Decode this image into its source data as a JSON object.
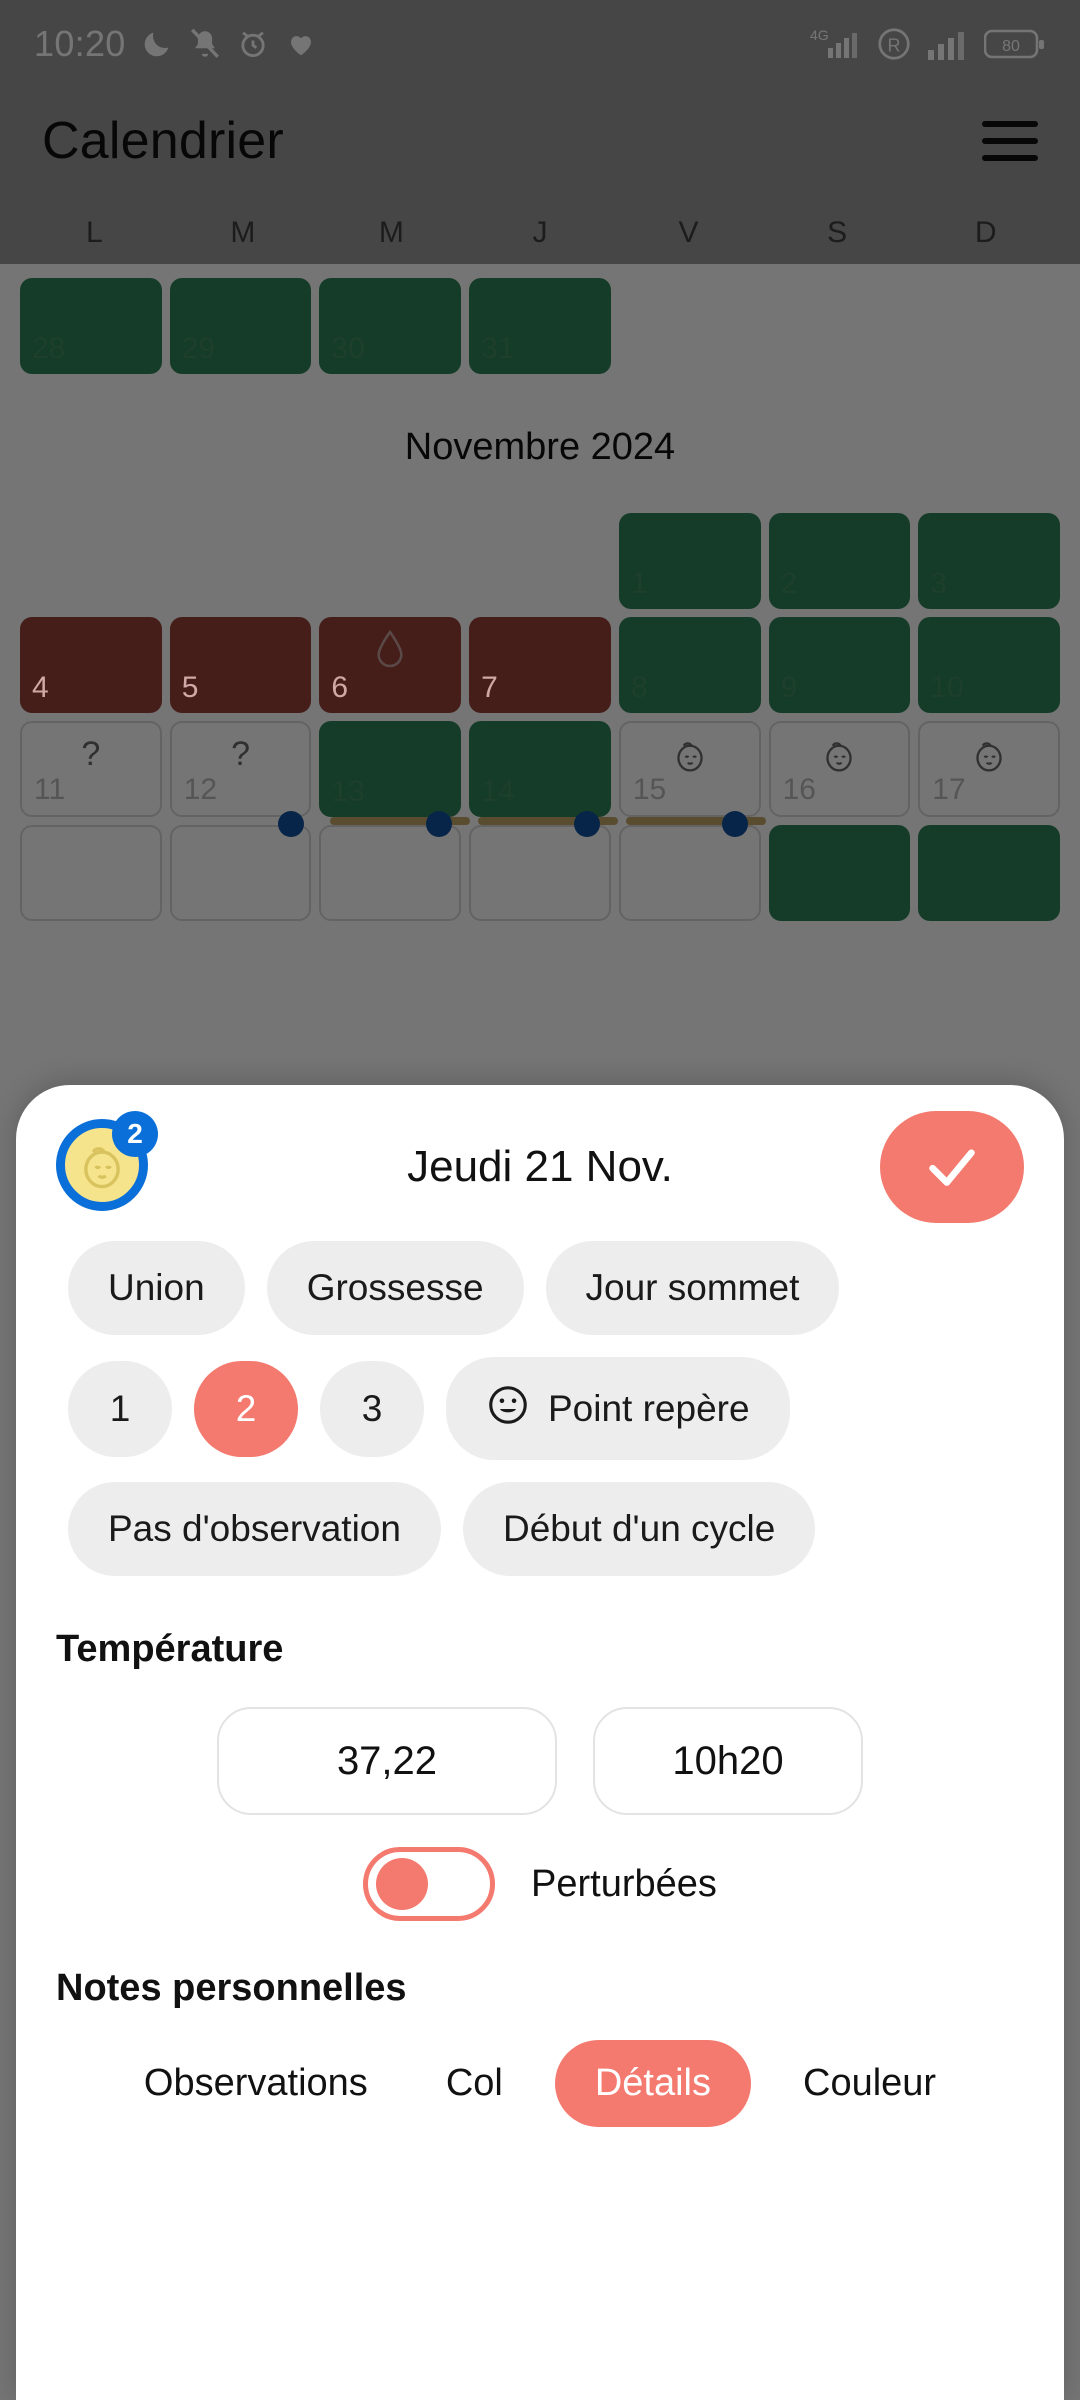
{
  "status_bar": {
    "time": "10:20",
    "left_icons": [
      "moon-icon",
      "bell-muted-icon",
      "alarm-icon",
      "heart-icon"
    ],
    "network_label": "4G",
    "roaming_label": "R",
    "battery_level": "80"
  },
  "app": {
    "title": "Calendrier",
    "menu_icon": "hamburger-icon"
  },
  "calendar": {
    "weekdays": [
      "L",
      "M",
      "M",
      "J",
      "V",
      "S",
      "D"
    ],
    "prev_month_row": [
      {
        "day": "28",
        "state": "green"
      },
      {
        "day": "29",
        "state": "green"
      },
      {
        "day": "30",
        "state": "green"
      },
      {
        "day": "31",
        "state": "green"
      }
    ],
    "month_label": "Novembre 2024",
    "weeks": [
      [
        {
          "day": "",
          "state": "blank"
        },
        {
          "day": "",
          "state": "blank"
        },
        {
          "day": "",
          "state": "blank"
        },
        {
          "day": "",
          "state": "blank"
        },
        {
          "day": "1",
          "state": "green"
        },
        {
          "day": "2",
          "state": "green"
        },
        {
          "day": "3",
          "state": "green"
        }
      ],
      [
        {
          "day": "4",
          "state": "red"
        },
        {
          "day": "5",
          "state": "red"
        },
        {
          "day": "6",
          "state": "red",
          "glyph": "droplet-icon"
        },
        {
          "day": "7",
          "state": "red"
        },
        {
          "day": "8",
          "state": "green"
        },
        {
          "day": "9",
          "state": "green"
        },
        {
          "day": "10",
          "state": "green"
        }
      ],
      [
        {
          "day": "11",
          "state": "empty",
          "glyph": "question-mark"
        },
        {
          "day": "12",
          "state": "empty",
          "glyph": "question-mark"
        },
        {
          "day": "13",
          "state": "green"
        },
        {
          "day": "14",
          "state": "green"
        },
        {
          "day": "15",
          "state": "empty",
          "glyph": "baby-face-icon"
        },
        {
          "day": "16",
          "state": "empty",
          "glyph": "baby-face-icon"
        },
        {
          "day": "17",
          "state": "empty",
          "glyph": "baby-face-icon"
        }
      ],
      [
        {
          "day": "",
          "state": "empty"
        },
        {
          "day": "",
          "state": "empty"
        },
        {
          "day": "",
          "state": "empty"
        },
        {
          "day": "",
          "state": "empty"
        },
        {
          "day": "",
          "state": "empty"
        },
        {
          "day": "",
          "state": "green"
        },
        {
          "day": "",
          "state": "green"
        }
      ]
    ]
  },
  "sheet": {
    "date_title": "Jeudi 21 Nov.",
    "badge_count": "2",
    "badge_icon": "baby-face-icon",
    "confirm_icon": "check-icon",
    "chip_rows": [
      [
        {
          "label": "Union",
          "selected": false,
          "shape": "pill"
        },
        {
          "label": "Grossesse",
          "selected": false,
          "shape": "pill"
        },
        {
          "label": "Jour sommet",
          "selected": false,
          "shape": "pill"
        }
      ],
      [
        {
          "label": "1",
          "selected": false,
          "shape": "round"
        },
        {
          "label": "2",
          "selected": true,
          "shape": "round"
        },
        {
          "label": "3",
          "selected": false,
          "shape": "round"
        },
        {
          "label": "Point repère",
          "selected": false,
          "shape": "pill",
          "icon": "smiley-icon"
        }
      ],
      [
        {
          "label": "Pas d'observation",
          "selected": false,
          "shape": "pill"
        },
        {
          "label": "Début d'un cycle",
          "selected": false,
          "shape": "pill"
        }
      ]
    ],
    "temperature": {
      "section_label": "Température",
      "value": "37,22",
      "time": "10h20",
      "toggle_label": "Perturbées",
      "toggle_on": false
    },
    "notes": {
      "section_label": "Notes personnelles",
      "tabs": [
        {
          "label": "Observations",
          "active": false
        },
        {
          "label": "Col",
          "active": false
        },
        {
          "label": "Détails",
          "active": true
        },
        {
          "label": "Couleur",
          "active": false
        }
      ]
    }
  },
  "colors": {
    "accent": "#f4796e",
    "fertile_green": "#2e8457",
    "menstruation_red": "#963f38",
    "badge_blue": "#0a6fd8",
    "marker_tan": "#c2a766"
  }
}
